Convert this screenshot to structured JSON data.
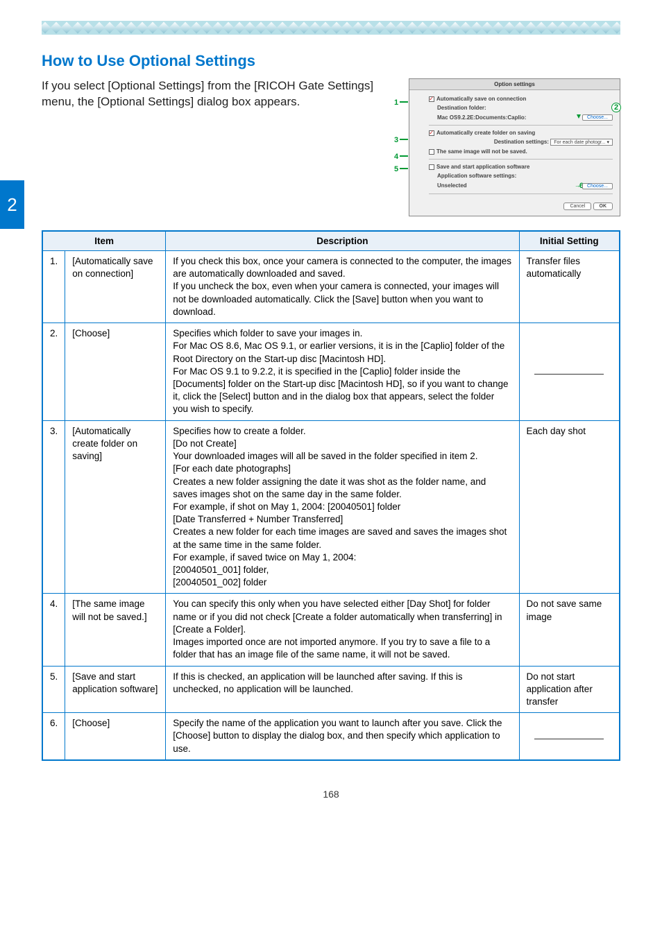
{
  "sideTab": "2",
  "heading": "How to Use Optional Settings",
  "intro": "If you select [Optional Settings] from the [RICOH Gate Settings] menu, the [Optional Settings] dialog box appears.",
  "dialog": {
    "title": "Option settings",
    "line1": "Automatically save on connection",
    "dest_label": "Destination folder:",
    "dest_path": "Mac OS9.2.2E:Documents:Caplio:",
    "choose": "Choose...",
    "line3": "Automatically create folder on saving",
    "dest_set_label": "Destination settings:",
    "dest_set_val": "For each date photogr...",
    "line4": "The same image will not be saved.",
    "line5": "Save and start application software",
    "app_label": "Application software settings:",
    "app_val": "Unselected",
    "cancel": "Cancel",
    "ok": "OK",
    "n1": "1",
    "n2": "2",
    "n3": "3",
    "n4": "4",
    "n5": "5",
    "n6": "6"
  },
  "tableHeaders": {
    "item": "Item",
    "desc": "Description",
    "init": "Initial Setting"
  },
  "rows": [
    {
      "num": "1.",
      "item": "[Automatically save on connection]",
      "desc": "If you check this box, once your camera is connected to the computer, the images are automatically downloaded and saved.\nIf you uncheck the box, even when your camera is connected, your images will not be downloaded automatically. Click the [Save] button when you want to download.",
      "init": "Transfer files automatically"
    },
    {
      "num": "2.",
      "item": "[Choose]",
      "desc": "Specifies which folder to save your images in.\nFor Mac OS 8.6, Mac OS 9.1, or earlier versions, it is in the [Caplio] folder of the Root Directory on the Start-up disc [Macintosh HD].\nFor Mac OS 9.1 to 9.2.2, it is specified in the [Caplio] folder inside the [Documents] folder on the Start-up disc [Macintosh HD], so if you want to change it, click the [Select] button and in the dialog box that appears, select the folder you wish to specify.",
      "init": "__BLANK__"
    },
    {
      "num": "3.",
      "item": "[Automatically create folder on saving]",
      "desc": "Specifies how to create a folder.\n[Do not Create]\nYour downloaded images will all be saved in the folder specified in item 2.\n[For each date photographs]\nCreates a new folder assigning the date it was shot as the folder name, and saves images shot on the same day in the same folder.\nFor example, if shot on May 1, 2004: [20040501] folder\n[Date Transferred + Number Transferred]\nCreates a new folder for each time images are saved and saves the images shot at the same time in the same folder.\nFor example, if saved twice on May 1, 2004:\n[20040501_001] folder,\n[20040501_002] folder",
      "init": "Each day shot"
    },
    {
      "num": "4.",
      "item": "[The same image will not be saved.]",
      "desc": "You can specify this only when you have selected either [Day Shot] for folder name or if you did not check [Create a folder automatically when transferring] in [Create a Folder].\nImages imported once are not imported anymore. If you try to save a file to a folder that has an image file of the same name, it will not be saved.",
      "init": "Do not save same image"
    },
    {
      "num": "5.",
      "item": "[Save and start application software]",
      "desc": "If this is checked, an application will be launched after saving. If this is unchecked, no application will be launched.",
      "init": "Do not start application after transfer"
    },
    {
      "num": "6.",
      "item": "[Choose]",
      "desc": "Specify the name of the application you want to launch after you save. Click the [Choose] button to display the dialog box, and then specify which application to use.",
      "init": "__BLANK__"
    }
  ],
  "pageNum": "168"
}
